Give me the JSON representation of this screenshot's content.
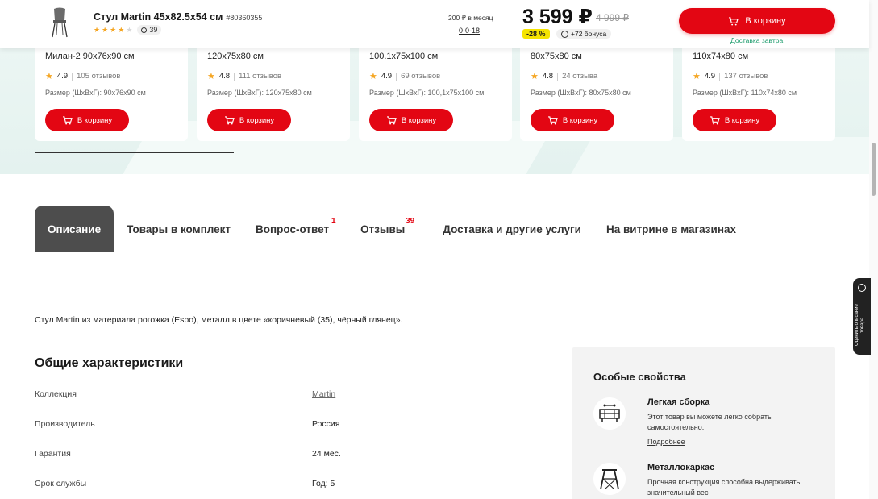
{
  "header": {
    "title": "Стул Martin 45x82.5x54 см",
    "sku": "#80360355",
    "rating_stars": 4,
    "reviews_count": "39",
    "installment": "200 ₽ в месяц",
    "installment_code": "0-0-18",
    "price": "3 599 ₽",
    "old_price": "4 999 ₽",
    "discount": "-28 %",
    "bonus": "+72 бонуса",
    "cart_button": "В корзину",
    "delivery": "Доставка завтра"
  },
  "recommendations": [
    {
      "name": "Милан-2 90x76x90 см",
      "rating": "4.9",
      "reviews": "105 отзывов",
      "size": "Размер (ШxВxГ): 90x76x90 см",
      "button": "В корзину"
    },
    {
      "name": "120x75x80 см",
      "rating": "4.8",
      "reviews": "111 отзывов",
      "size": "Размер (ШxВxГ): 120x75x80 см",
      "button": "В корзину"
    },
    {
      "name": "100.1x75x100 см",
      "rating": "4.9",
      "reviews": "69 отзывов",
      "size": "Размер (ШxВxГ): 100,1x75x100 см",
      "button": "В корзину"
    },
    {
      "name": "80x75x80 см",
      "rating": "4.8",
      "reviews": "24 отзыва",
      "size": "Размер (ШxВxГ): 80x75x80 см",
      "button": "В корзину"
    },
    {
      "name": "110x74x80 см",
      "rating": "4.9",
      "reviews": "137 отзывов",
      "size": "Размер (ШxВxГ): 110x74x80 см",
      "button": "В корзину"
    }
  ],
  "tabs": [
    {
      "label": "Описание",
      "badge": ""
    },
    {
      "label": "Товары в комплект",
      "badge": ""
    },
    {
      "label": "Вопрос-ответ",
      "badge": "1"
    },
    {
      "label": "Отзывы",
      "badge": "39"
    },
    {
      "label": "Доставка и другие услуги",
      "badge": ""
    },
    {
      "label": "На витрине в магазинах",
      "badge": ""
    }
  ],
  "description": "Стул Martin из материала рогожка (Espo), металл в цвете «коричневый (35), чёрный глянец».",
  "specs": {
    "title": "Общие характеристики",
    "rows": [
      {
        "key": "Коллекция",
        "value": "Martin"
      },
      {
        "key": "Производитель",
        "value": "Россия"
      },
      {
        "key": "Гарантия",
        "value": "24 мес."
      },
      {
        "key": "Срок службы",
        "value": "Год: 5"
      }
    ]
  },
  "features": {
    "title": "Особые свойства",
    "items": [
      {
        "name": "Легкая сборка",
        "text": "Этот товар вы можете легко собрать самостоятельно.",
        "more": "Подробнее",
        "icon": "assembly-icon"
      },
      {
        "name": "Металлокаркас",
        "text": "Прочная конструкция способна выдерживать значительный вес",
        "more": "",
        "icon": "metal-frame-icon"
      }
    ]
  },
  "rate_widget": "Оценить описание товара",
  "colors": {
    "accent": "#e30613",
    "discount_bg": "#f5e400",
    "delivery": "#1a9b6b",
    "active_tab": "#4d4d4d"
  }
}
